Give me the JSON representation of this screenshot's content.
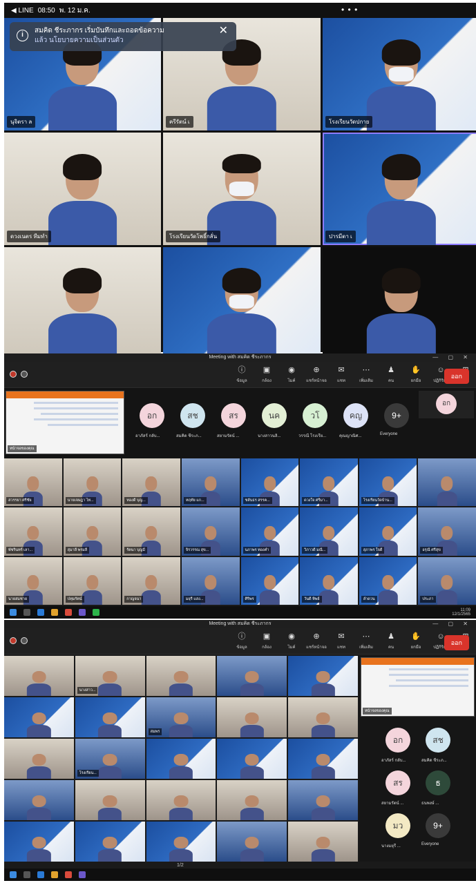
{
  "phone": {
    "status_app": "◀ LINE",
    "status_time": "08:50",
    "status_date": "พ. 12 ม.ค.",
    "status_dots": "• • •",
    "notification_line1": "สมคิด ชีระภากร เริ่มบันทึกและถอดข้อความ",
    "notification_line2": "แล้ว นโยบายความเป็นส่วนตัว",
    "participants": [
      {
        "label": "นุจิตรา ล",
        "style": "slide"
      },
      {
        "label": "ครีรัตน์ เ",
        "style": "room"
      },
      {
        "label": "โรงเรียนวัดปกาย",
        "style": "slide"
      },
      {
        "label": "ดวงเนตร ทีมทำ",
        "style": "room"
      },
      {
        "label": "โรงเรียนวัดโพธิ์กลั่น",
        "style": "room"
      },
      {
        "label": "ปารมีตา เ",
        "style": "slide"
      },
      {
        "label": "",
        "style": "room"
      },
      {
        "label": "",
        "style": "slide"
      },
      {
        "label": "",
        "style": "dark"
      }
    ]
  },
  "desktop1": {
    "title": "Meeting with สมคิด ชีระภากร",
    "leave_label": "ออก",
    "toolbar": [
      "ข้อมูล",
      "กล้อง",
      "ไมค์",
      "แชร์หน้าจอ",
      "แชท",
      "เพิ่มเติม",
      "คน",
      "ยกมือ",
      "ปฏิกิริยา",
      "ห้อง",
      "แอป"
    ],
    "share_label": "หน้าจอของคุณ",
    "avatars": [
      {
        "initials": "อก",
        "name": "อาภัสร์ กลับ...",
        "color": "#f4d5dc"
      },
      {
        "initials": "สช",
        "name": "สมคิด ชีระภ...",
        "color": "#cfe5ef"
      },
      {
        "initials": "สร",
        "name": "สยามรัตน์ ...",
        "color": "#f4d5dc"
      },
      {
        "initials": "นค",
        "name": "นางสาวนลิ...",
        "color": "#e3efd5"
      },
      {
        "initials": "วโ",
        "name": "วรรณี โรงเรีย...",
        "color": "#d7f0d3"
      },
      {
        "initials": "คญ",
        "name": "คุณญาณิศ...",
        "color": "#dde3f7"
      },
      {
        "initials": "9+",
        "name": "Everyone",
        "color": "#3a3a3a"
      }
    ],
    "extra_avatar": "อก",
    "cells": [
      "สวรรยา ศรีชัย",
      "นายเจษฎา ไท...",
      "ทองดี บุญ...",
      "หฤทัย แก...",
      "ชลันธร สรรค...",
      "ดวงใจ ศรีมา...",
      "โรงเรียนวัดบ้าน...",
      "",
      "พัชรินทร์ เลา...",
      "สุมาลี พรมลี",
      "รัตนา บุญมี",
      "จิรวรรณ สุข...",
      "นภาพร ทองคำ",
      "วิภาวดี มณี...",
      "สุภาพร ใจดี",
      "อรุณี ศรีสุข",
      "นายสมชาย",
      "ปทุมรัตน์",
      "กาญจนา",
      "มยุรี แสง...",
      "ศิริพร",
      "วันดี ทิพย์",
      "ลำดวน",
      "ประภา"
    ],
    "tray_time": "11:09",
    "tray_date": "12/1/2565"
  },
  "desktop2": {
    "title": "Meeting with สมคิด ชีระภากร",
    "leave_label": "ออก",
    "toolbar": [
      "ข้อมูล",
      "กล้อง",
      "ไมค์",
      "แชร์หน้าจอ",
      "แชท",
      "เพิ่มเติม",
      "คน",
      "ยกมือ",
      "ปฏิกิริยา",
      "ห้อง",
      "แอป"
    ],
    "share_label": "หน้าจอของคุณ",
    "avatars": [
      {
        "initials": "อก",
        "name": "อาภัสร์ กลับ...",
        "color": "#f4d5dc"
      },
      {
        "initials": "สช",
        "name": "สมคิด ชีระภ...",
        "color": "#cfe5ef"
      },
      {
        "initials": "สร",
        "name": "สยามรัตน์ ...",
        "color": "#f4d5dc"
      },
      {
        "initials": "ธ",
        "name": "ธนพงษ์ ...",
        "color": "#2e4a3a"
      },
      {
        "initials": "มว",
        "name": "นางมยุรี ...",
        "color": "#f3e9c4"
      },
      {
        "initials": "9+",
        "name": "Everyone",
        "color": "#3a3a3a"
      }
    ],
    "cells": [
      "",
      "นางสาว...",
      "",
      "",
      "",
      "",
      "",
      "สมพร",
      "",
      "",
      "",
      "โรงเรียน...",
      "",
      "",
      "",
      "",
      "",
      "",
      "",
      "",
      "",
      "",
      "",
      "",
      ""
    ],
    "page_indicator": "1/2"
  }
}
